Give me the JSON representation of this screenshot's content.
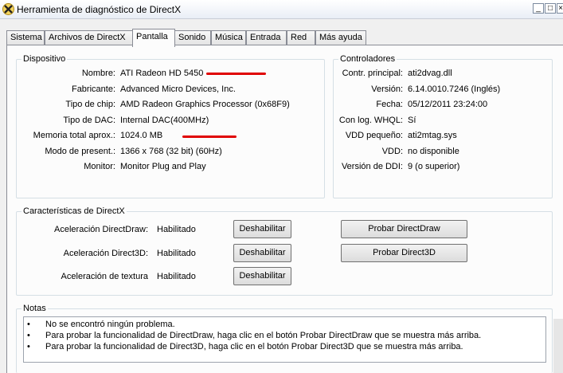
{
  "window": {
    "title": "Herramienta de diagnóstico de DirectX",
    "app_icon": "directx-icon",
    "controls": {
      "minimize": "_",
      "maximize": "□",
      "close": "×"
    }
  },
  "tabs": [
    {
      "label": "Sistema"
    },
    {
      "label": "Archivos de DirectX"
    },
    {
      "label": "Pantalla",
      "active": true
    },
    {
      "label": "Sonido"
    },
    {
      "label": "Música"
    },
    {
      "label": "Entrada"
    },
    {
      "label": "Red"
    },
    {
      "label": "Más ayuda"
    }
  ],
  "device": {
    "title": "Dispositivo",
    "rows": [
      {
        "label": "Nombre:",
        "value": "ATI Radeon HD 5450"
      },
      {
        "label": "Fabricante:",
        "value": "Advanced Micro Devices, Inc."
      },
      {
        "label": "Tipo de chip:",
        "value": "AMD Radeon Graphics Processor (0x68F9)"
      },
      {
        "label": "Tipo de DAC:",
        "value": "Internal DAC(400MHz)"
      },
      {
        "label": "Memoria total aprox.:",
        "value": "1024.0 MB"
      },
      {
        "label": "Modo de present.:",
        "value": "1366 x 768 (32 bit) (60Hz)"
      },
      {
        "label": "Monitor:",
        "value": "Monitor Plug and Play"
      }
    ]
  },
  "drivers": {
    "title": "Controladores",
    "rows": [
      {
        "label": "Contr. principal:",
        "value": "ati2dvag.dll"
      },
      {
        "label": "Versión:",
        "value": "6.14.0010.7246 (Inglés)"
      },
      {
        "label": "Fecha:",
        "value": "05/12/2011 23:24:00"
      },
      {
        "label": "Con log. WHQL:",
        "value": "Sí"
      },
      {
        "label": "VDD pequeño:",
        "value": "ati2mtag.sys"
      },
      {
        "label": "VDD:",
        "value": "no disponible"
      },
      {
        "label": "Versión de DDI:",
        "value": "9 (o superior)"
      }
    ]
  },
  "features": {
    "title": "Características de DirectX",
    "rows": [
      {
        "label": "Aceleración DirectDraw:",
        "value": "Habilitado",
        "button": "Deshabilitar"
      },
      {
        "label": "Aceleración Direct3D:",
        "value": "Habilitado",
        "button": "Deshabilitar"
      },
      {
        "label": "Aceleración de textura",
        "value": "Habilitado",
        "button": "Deshabilitar"
      }
    ],
    "test_directdraw": "Probar DirectDraw",
    "test_direct3d": "Probar Direct3D"
  },
  "notes": {
    "title": "Notas",
    "bullet": "•",
    "items": [
      "No se encontró ningún problema.",
      "Para probar la funcionalidad de DirectDraw, haga clic en el botón Probar DirectDraw que se muestra más arriba.",
      "Para probar la funcionalidad de Direct3D, haga clic en el botón Probar Direct3D que se muestra más arriba."
    ]
  },
  "colors": {
    "redline": "#e00000",
    "group_border": "#d5dfe5"
  }
}
